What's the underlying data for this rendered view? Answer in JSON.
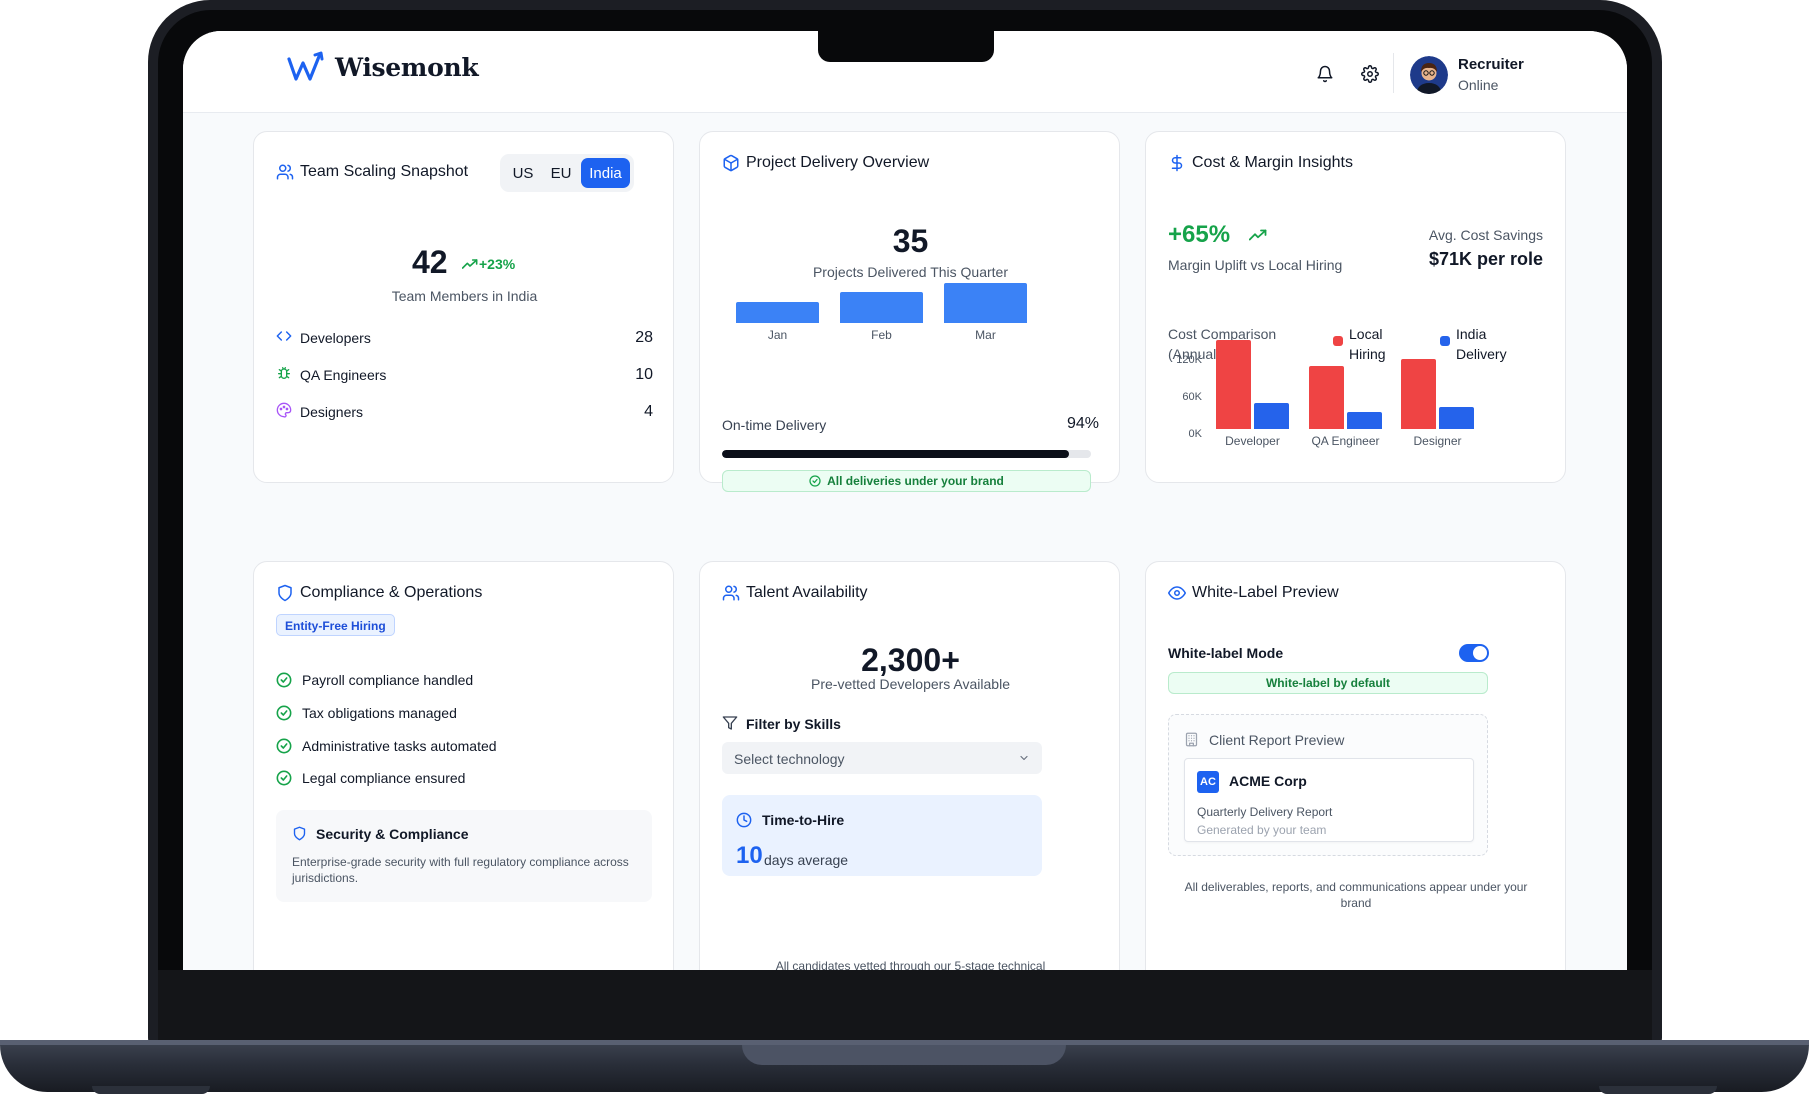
{
  "brand": {
    "name": "Wisemonk"
  },
  "header": {
    "user_name": "Recruiter",
    "user_status": "Online"
  },
  "team_scaling": {
    "title": "Team Scaling Snapshot",
    "regions": [
      "US",
      "EU",
      "India"
    ],
    "active_region": "India",
    "count": "42",
    "growth": "+23%",
    "caption": "Team Members in India",
    "roles": [
      {
        "label": "Developers",
        "value": "28"
      },
      {
        "label": "QA Engineers",
        "value": "10"
      },
      {
        "label": "Designers",
        "value": "4"
      }
    ]
  },
  "project_delivery": {
    "title": "Project Delivery Overview",
    "count": "35",
    "caption": "Projects Delivered This Quarter",
    "on_time_label": "On-time Delivery",
    "on_time_value": "94%",
    "on_time_fraction": 0.94,
    "badge": "All deliveries under your brand"
  },
  "cost_margin": {
    "title": "Cost & Margin Insights",
    "uplift": "+65%",
    "uplift_caption": "Margin Uplift vs Local Hiring",
    "savings_label": "Avg. Cost Savings",
    "savings_value": "$71K per role",
    "chart_title": "Cost Comparison (Annual)"
  },
  "chart_data": [
    {
      "type": "bar",
      "title": "",
      "categories": [
        "Jan",
        "Feb",
        "Mar"
      ],
      "values": [
        17,
        25,
        32
      ],
      "ylim": [
        0,
        32
      ],
      "grid": false,
      "color": "#3b82f6"
    },
    {
      "type": "bar",
      "title": "Cost Comparison (Annual)",
      "categories": [
        "Developer",
        "QA Engineer",
        "Designer"
      ],
      "series": [
        {
          "name": "Local Hiring",
          "color": "#ef4444",
          "values": [
            123000,
            87000,
            97000
          ]
        },
        {
          "name": "India Delivery",
          "color": "#2563eb",
          "values": [
            36000,
            24000,
            30000
          ]
        }
      ],
      "yticks": [
        "120K",
        "60K",
        "0K"
      ],
      "ylim": [
        0,
        120000
      ],
      "legend": "top-right",
      "grid": false
    }
  ],
  "compliance": {
    "title": "Compliance & Operations",
    "tag": "Entity-Free Hiring",
    "items": [
      "Payroll compliance handled",
      "Tax obligations managed",
      "Administrative tasks automated",
      "Legal compliance ensured"
    ],
    "security_title": "Security & Compliance",
    "security_text": "Enterprise-grade security with full regulatory compliance across jurisdictions."
  },
  "talent": {
    "title": "Talent Availability",
    "count": "2,300+",
    "caption": "Pre-vetted Developers Available",
    "filter_label": "Filter by Skills",
    "select_placeholder": "Select technology",
    "tth_title": "Time-to-Hire",
    "tth_value": "10",
    "tth_unit": "days average",
    "footnote": "All candidates vetted through our 5-stage technical"
  },
  "white_label": {
    "title": "White-Label Preview",
    "mode_label": "White-label Mode",
    "mode_on": true,
    "badge": "White-label by default",
    "preview_title": "Client Report Preview",
    "client_initials": "AC",
    "client_name": "ACME Corp",
    "report_title": "Quarterly Delivery Report",
    "report_sub": "Generated by your team",
    "footnote": "All deliverables, reports, and communications appear under your brand"
  }
}
